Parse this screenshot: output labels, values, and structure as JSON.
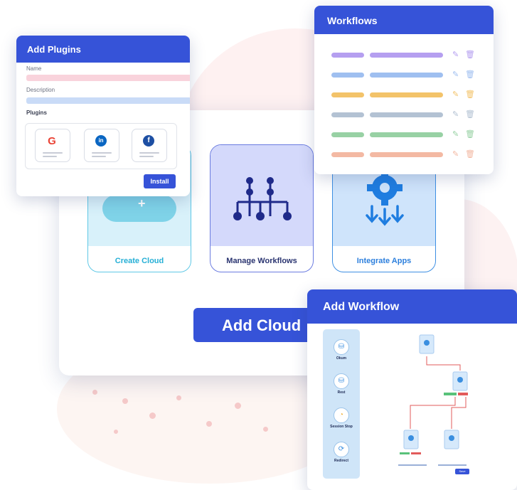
{
  "tiles": {
    "create_cloud": "Create Cloud",
    "manage_workflows": "Manage Workflows",
    "integrate_apps": "Integrate Apps"
  },
  "add_cloud_button": "Add Cloud",
  "plugins_panel": {
    "title": "Add Plugins",
    "name_label": "Name",
    "description_label": "Description",
    "plugins_label": "Plugins",
    "plugins": [
      {
        "icon": "google-icon",
        "glyph": "G",
        "color": "#ea4335"
      },
      {
        "icon": "linkedin-icon",
        "glyph": "in",
        "color": "#0a66c2"
      },
      {
        "icon": "facebook-icon",
        "glyph": "f",
        "color": "#1d4fa3"
      }
    ],
    "install_label": "Install",
    "name_bar_color": "#f9d3dc",
    "description_bar_color": "#c9dbf7"
  },
  "workflows_panel": {
    "title": "Workflows",
    "rows": [
      {
        "color": "#b59ff0"
      },
      {
        "color": "#9fbff0"
      },
      {
        "color": "#f3c36a"
      },
      {
        "color": "#b3c2d3"
      },
      {
        "color": "#98d1a4"
      },
      {
        "color": "#f3b9a3"
      }
    ],
    "edit_icon": "pencil-icon",
    "delete_icon": "trash-icon"
  },
  "add_workflow_panel": {
    "title": "Add Workflow",
    "nodes": [
      {
        "label": "Okum",
        "icon": "database-icon"
      },
      {
        "label": "Rest",
        "icon": "database-icon"
      },
      {
        "label": "Session Stop",
        "icon": "timer-icon"
      },
      {
        "label": "Redirect",
        "icon": "redirect-icon"
      }
    ],
    "run_label": "Save"
  },
  "colors": {
    "accent": "#3653d8",
    "cloud": "#25afd6",
    "workflow": "#2a3470",
    "integrate": "#2c7fdd"
  }
}
